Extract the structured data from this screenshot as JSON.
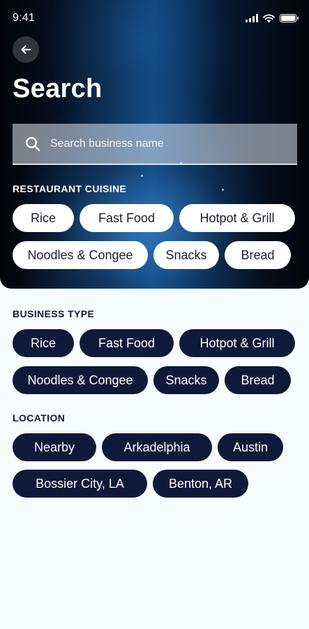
{
  "status_bar": {
    "time": "9:41"
  },
  "header": {
    "title": "Search"
  },
  "search": {
    "placeholder": "Search business name"
  },
  "restaurant_cuisine": {
    "label": "RESTAURANT CUISINE",
    "chips": [
      "Rice",
      "Fast Food",
      "Hotpot & Grill",
      "Noodles & Congee",
      "Snacks",
      "Bread"
    ]
  },
  "business_type": {
    "label": "BUSINESS TYPE",
    "chips": [
      "Rice",
      "Fast Food",
      "Hotpot & Grill",
      "Noodles & Congee",
      "Snacks",
      "Bread"
    ]
  },
  "location": {
    "label": "LOCATION",
    "chips": [
      "Nearby",
      "Arkadelphia",
      "Austin",
      "Bossier City, LA",
      "Benton, AR"
    ]
  },
  "colors": {
    "navy": "#0f1a3a",
    "background": "#f5fdfe",
    "chip_light": "#ffffff"
  },
  "icons": [
    "arrow-left-icon",
    "search-icon",
    "signal-icon",
    "wifi-icon",
    "battery-icon"
  ]
}
